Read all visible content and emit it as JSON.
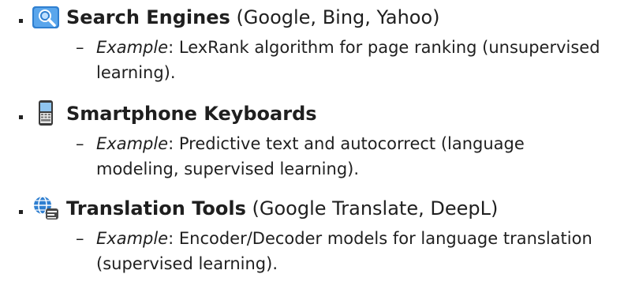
{
  "items": [
    {
      "icon": "magnifier-globe-icon",
      "title": "Search Engines",
      "paren": "(Google, Bing, Yahoo)",
      "example_label": "Example",
      "example_text": ": LexRank algorithm for page ranking (unsupervised learning)."
    },
    {
      "icon": "smartphone-keyboard-icon",
      "title": "Smartphone Keyboards",
      "paren": "",
      "example_label": "Example",
      "example_text": ": Predictive text and autocorrect (language modeling, supervised learning)."
    },
    {
      "icon": "translation-globe-icon",
      "title": "Translation Tools",
      "paren": "(Google Translate, DeepL)",
      "example_label": "Example",
      "example_text": ": Encoder/Decoder models for language translation (supervised learning)."
    }
  ],
  "dash": "–",
  "colors": {
    "text": "#1f1f1f",
    "bullet": "#222222",
    "icon_blue": "#2f7fd0"
  }
}
